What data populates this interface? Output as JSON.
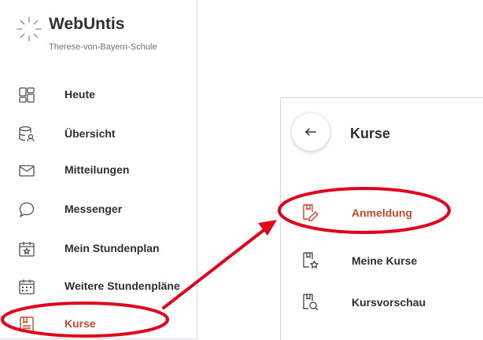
{
  "app": {
    "title": "WebUntis",
    "school": "Therese-von-Bayern-Schule"
  },
  "sidebar": {
    "items": [
      {
        "label": "Heute",
        "icon": "dashboard-icon"
      },
      {
        "label": "Übersicht",
        "icon": "database-user-icon"
      },
      {
        "label": "Mitteilungen",
        "icon": "envelope-icon"
      },
      {
        "label": "Messenger",
        "icon": "chat-bubble-icon"
      },
      {
        "label": "Mein Stundenplan",
        "icon": "calendar-star-icon"
      },
      {
        "label": "Weitere Stundenpläne",
        "icon": "calendar-grid-icon"
      },
      {
        "label": "Kurse",
        "icon": "courses-icon",
        "active": true
      }
    ]
  },
  "courses_panel": {
    "title": "Kurse",
    "back_icon": "arrow-left-icon",
    "items": [
      {
        "label": "Anmeldung",
        "icon": "book-pencil-icon",
        "active": true
      },
      {
        "label": "Meine Kurse",
        "icon": "book-star-icon"
      },
      {
        "label": "Kursvorschau",
        "icon": "book-search-icon"
      }
    ]
  },
  "colors": {
    "accent": "#c24a2c",
    "annotation": "#e3001b",
    "text": "#2b2f33"
  }
}
